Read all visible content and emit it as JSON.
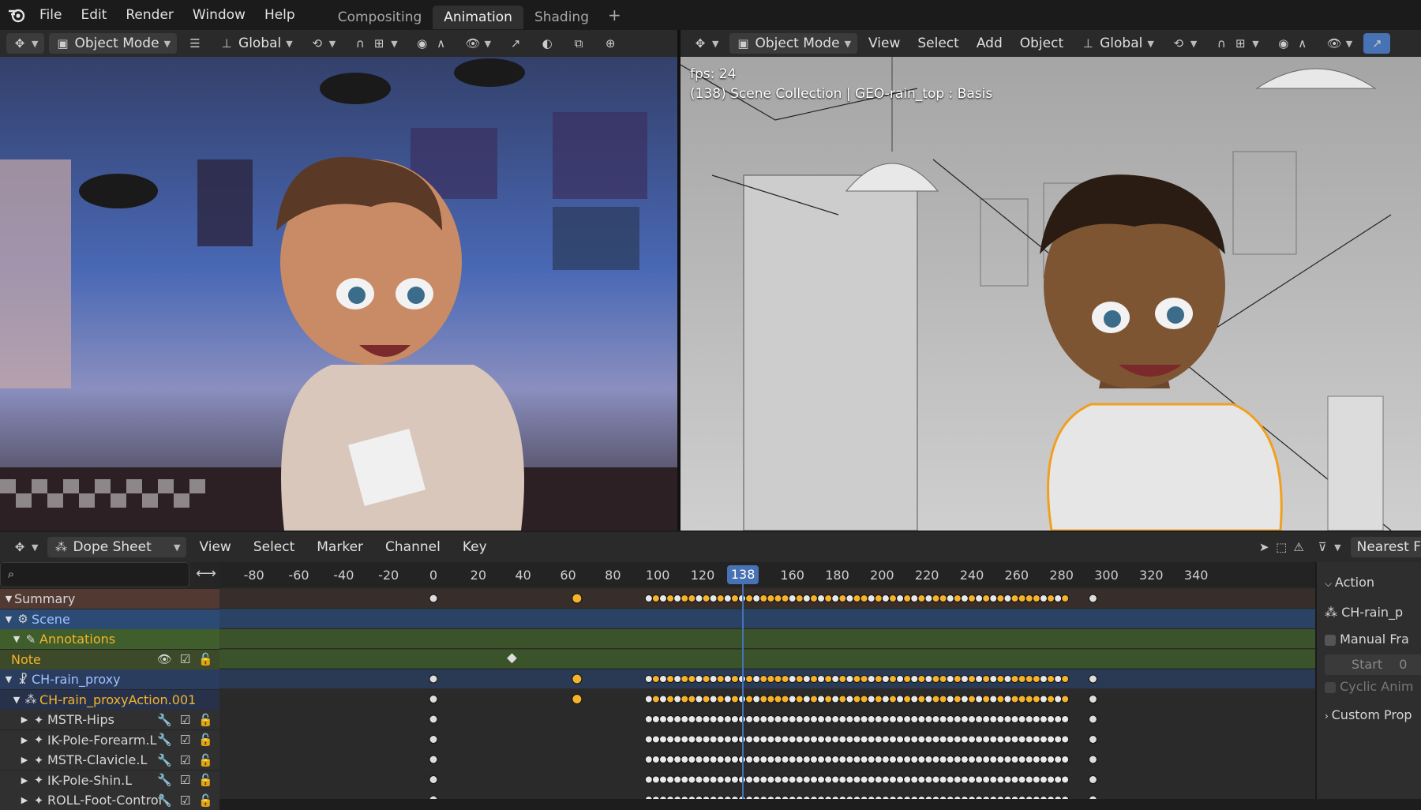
{
  "menu": [
    "File",
    "Edit",
    "Render",
    "Window",
    "Help"
  ],
  "workspaces": [
    {
      "label": "Compositing",
      "active": false
    },
    {
      "label": "Animation",
      "active": true
    },
    {
      "label": "Shading",
      "active": false
    }
  ],
  "workspace_add": "+",
  "left_header": {
    "mode": "Object Mode",
    "orientation": "Global"
  },
  "right_header": {
    "mode": "Object Mode",
    "menus": [
      "View",
      "Select",
      "Add",
      "Object"
    ],
    "orientation": "Global"
  },
  "right_viewport": {
    "fps": "fps: 24",
    "info": "(138) Scene Collection | GEO-rain_top : Basis"
  },
  "dopesheet": {
    "editor_type": "Dope Sheet",
    "menus": [
      "View",
      "Select",
      "Marker",
      "Channel",
      "Key"
    ],
    "snapping": "Nearest F",
    "ruler": [
      -80,
      -60,
      -40,
      -20,
      0,
      20,
      40,
      60,
      80,
      100,
      120,
      138,
      160,
      180,
      200,
      220,
      240,
      260,
      280,
      300,
      320,
      340
    ],
    "current_frame": "138",
    "channels": [
      {
        "label": "Summary",
        "level": 0,
        "expanded": true,
        "kind": "summary"
      },
      {
        "label": "Scene",
        "level": 0,
        "expanded": true,
        "kind": "scene"
      },
      {
        "label": "Annotations",
        "level": 1,
        "expanded": true,
        "kind": "annot"
      },
      {
        "label": "Note",
        "level": 0,
        "expanded": null,
        "kind": "note"
      },
      {
        "label": "CH-rain_proxy",
        "level": 0,
        "expanded": true,
        "kind": "object"
      },
      {
        "label": "CH-rain_proxyAction.001",
        "level": 1,
        "expanded": true,
        "kind": "action"
      },
      {
        "label": "MSTR-Hips",
        "level": 2,
        "expanded": false,
        "kind": "bone"
      },
      {
        "label": "IK-Pole-Forearm.L",
        "level": 2,
        "expanded": false,
        "kind": "bone"
      },
      {
        "label": "MSTR-Clavicle.L",
        "level": 2,
        "expanded": false,
        "kind": "bone"
      },
      {
        "label": "IK-Pole-Shin.L",
        "level": 2,
        "expanded": false,
        "kind": "bone"
      },
      {
        "label": "ROLL-Foot-Control",
        "level": 2,
        "expanded": false,
        "kind": "bone"
      }
    ]
  },
  "sidebar": {
    "section": "Action",
    "action_name": "CH-rain_p",
    "manual_frame": "Manual Fra",
    "start": "Start",
    "start_value": "0",
    "cyclic": "Cyclic Anim",
    "custom": "Custom Prop"
  },
  "colors": {
    "accent": "#4772b3",
    "key_selected": "#f4b32b",
    "summary_bg": "#523a33",
    "scene_bg": "#2b4a74",
    "annot_bg": "#3f5e2b",
    "object_bg": "#2b3d5f"
  }
}
